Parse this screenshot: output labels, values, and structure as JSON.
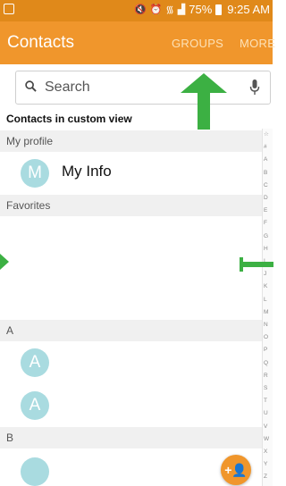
{
  "statusbar": {
    "battery": "75%",
    "time": "9:25 AM",
    "icons": [
      "screenshot-icon",
      "mute-icon",
      "alarm-icon",
      "wifi-icon",
      "signal-icon",
      "battery-icon"
    ]
  },
  "appbar": {
    "title": "Contacts",
    "groups_label": "GROUPS",
    "more_label": "MORE",
    "background": "#f0962c"
  },
  "search": {
    "placeholder": "Search"
  },
  "list": {
    "view_label": "Contacts in custom view",
    "my_profile_header": "My profile",
    "my_info": {
      "initial": "M",
      "name": "My Info"
    },
    "favorites_header": "Favorites",
    "section_a": "A",
    "section_a_rows": [
      {
        "initial": "A"
      },
      {
        "initial": "A"
      }
    ],
    "section_b": "B"
  },
  "index": [
    "☆",
    "#",
    "A",
    "B",
    "C",
    "D",
    "E",
    "F",
    "G",
    "H",
    "I",
    "J",
    "K",
    "L",
    "M",
    "N",
    "O",
    "P",
    "Q",
    "R",
    "S",
    "T",
    "U",
    "V",
    "W",
    "X",
    "Y",
    "Z"
  ],
  "fab": {
    "label": "+👤"
  },
  "annotation_color": "#3cb043"
}
